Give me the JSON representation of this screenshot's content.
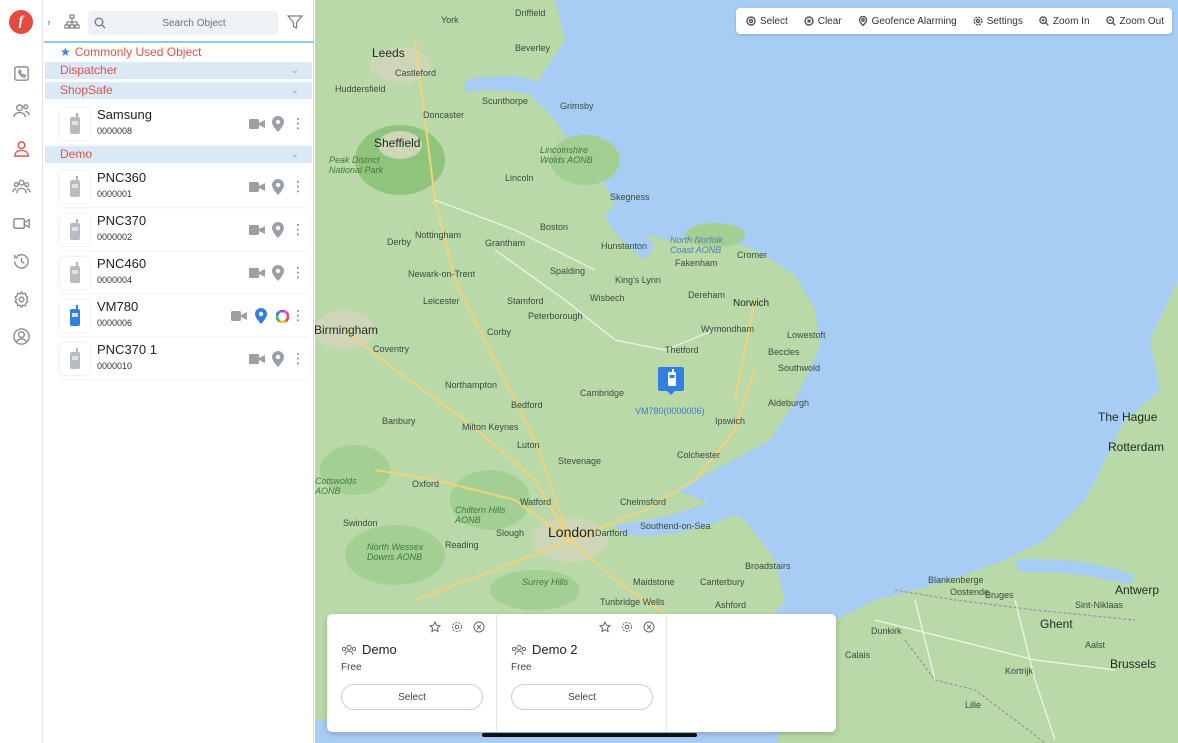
{
  "app": {
    "logo_letter": "f"
  },
  "colors": {
    "accent": "#e0524a",
    "group_bg": "#dbe9f7",
    "link_blue": "#3a7ad0",
    "sea": "#a8cdf4",
    "land": "#b9d9a8"
  },
  "rail": [
    {
      "name": "dispatch-console-icon"
    },
    {
      "name": "contacts-icon"
    },
    {
      "name": "user-icon"
    },
    {
      "name": "groups-icon"
    },
    {
      "name": "video-icon"
    },
    {
      "name": "history-icon"
    },
    {
      "name": "settings-icon"
    },
    {
      "name": "profile-icon"
    }
  ],
  "panel": {
    "search_placeholder": "Search Object",
    "common_label": "Commonly Used Object",
    "groups": {
      "dispatcher": "Dispatcher",
      "shopsafe": "ShopSafe",
      "demo": "Demo"
    },
    "devices": [
      {
        "name": "Samsung",
        "id": "0000008",
        "online": false
      },
      {
        "name": "PNC360",
        "id": "0000001",
        "online": false
      },
      {
        "name": "PNC370",
        "id": "0000002",
        "online": false
      },
      {
        "name": "PNC460",
        "id": "0000004",
        "online": false
      },
      {
        "name": "VM780",
        "id": "0000006",
        "online": true
      },
      {
        "name": "PNC370 1",
        "id": "0000010",
        "online": false
      }
    ]
  },
  "map": {
    "tools": {
      "select": "Select",
      "clear": "Clear",
      "geofence": "Geofence Alarming",
      "settings": "Settings",
      "zoom_in": "Zoom In",
      "zoom_out": "Zoom Out"
    },
    "marker_label": "VM780(0000006)",
    "labels": {
      "york": "York",
      "leeds": "Leeds",
      "sheffield": "Sheffield",
      "nottingham": "Nottingham",
      "leicester": "Leicester",
      "birmingham": "Birmingham",
      "northampton": "Northampton",
      "cambridge": "Cambridge",
      "london": "London",
      "norwich": "Norwich",
      "ipswich": "Ipswich",
      "colchester": "Colchester",
      "chelmsford": "Chelmsford",
      "oxford": "Oxford",
      "reading": "Reading",
      "the_hague": "The Hague",
      "rotterdam": "Rotterdam",
      "antwerp": "Antwerp",
      "ghent": "Ghent",
      "brussels": "Brussels",
      "bruges": "Bruges",
      "dunkirk": "Dunkirk",
      "peterborough": "Peterborough",
      "lincoln": "Lincoln",
      "grimsby": "Grimsby",
      "scunthorpe": "Scunthorpe",
      "doncaster": "Doncaster",
      "derby": "Derby",
      "coventry": "Coventry",
      "bedford": "Bedford",
      "milton_keynes": "Milton Keynes",
      "luton": "Luton",
      "stevenage": "Stevenage",
      "watford": "Watford",
      "swindon": "Swindon",
      "banbury": "Banbury",
      "kings_lynn": "King's Lynn",
      "skegness": "Skegness",
      "lowestoft": "Lowestoft",
      "thetford": "Thetford",
      "southend": "Southend-on-Sea",
      "canterbury": "Canterbury",
      "maidstone": "Maidstone",
      "north_norfolk": "North Norfolk Coast AONB",
      "lincs_wolds": "Lincolnshire Wolds AONB",
      "peak": "Peak District National Park",
      "chiltern": "Chiltern Hills AONB",
      "north_wessex": "North Wessex Downs AONB",
      "surrey": "Surrey Hills",
      "cotswolds": "Cotswolds AONB",
      "hunstanton": "Hunstanton",
      "fakenham": "Fakenham",
      "cromer": "Cromer",
      "wisbech": "Wisbech",
      "stamford": "Stamford",
      "grantham": "Grantham",
      "spalding": "Spalding",
      "boston": "Boston",
      "newark": "Newark-on-Trent",
      "dereham": "Dereham",
      "wymondham": "Wymondham",
      "beccles": "Beccles",
      "southwold": "Southwold",
      "aldeburgh": "Aldeburgh",
      "corby": "Corby",
      "huddersfield": "Huddersfield",
      "castleford": "Castleford",
      "beverley": "Beverley",
      "driffield": "Driffield",
      "ashford": "Ashford",
      "dartford": "Dartford",
      "slough": "Slough",
      "tunbridge": "Tunbridge Wells",
      "broadstairs": "Broadstairs",
      "blankenberge": "Blankenberge",
      "ostend": "Oostende",
      "kortrijk": "Kortrijk",
      "sint_niklaas": "Sint-Niklaas",
      "aalst": "Aalst",
      "lille": "Lille",
      "calais": "Calais"
    }
  },
  "groups_cards": [
    {
      "title": "Demo",
      "status": "Free",
      "select": "Select"
    },
    {
      "title": "Demo 2",
      "status": "Free",
      "select": "Select"
    }
  ]
}
